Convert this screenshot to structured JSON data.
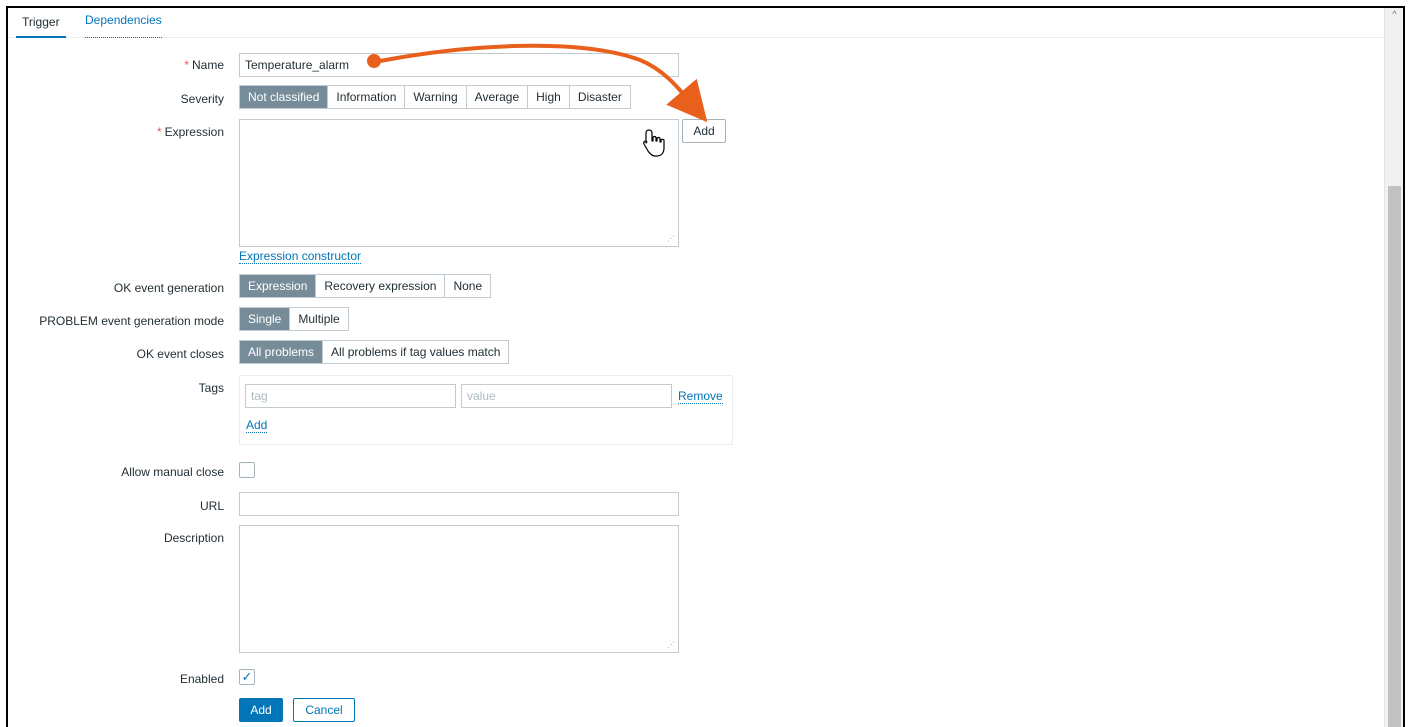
{
  "tabs": [
    {
      "label": "Trigger",
      "active": true
    },
    {
      "label": "Dependencies",
      "active": false
    }
  ],
  "form": {
    "name": {
      "label": "Name",
      "value": "Temperature_alarm",
      "required": true
    },
    "severity": {
      "label": "Severity",
      "options": [
        "Not classified",
        "Information",
        "Warning",
        "Average",
        "High",
        "Disaster"
      ],
      "selected": "Not classified"
    },
    "expression": {
      "label": "Expression",
      "required": true,
      "value": "",
      "add_label": "Add",
      "constructor_link": "Expression constructor"
    },
    "ok_event_generation": {
      "label": "OK event generation",
      "options": [
        "Expression",
        "Recovery expression",
        "None"
      ],
      "selected": "Expression"
    },
    "problem_mode": {
      "label": "PROBLEM event generation mode",
      "options": [
        "Single",
        "Multiple"
      ],
      "selected": "Single"
    },
    "ok_event_closes": {
      "label": "OK event closes",
      "options": [
        "All problems",
        "All problems if tag values match"
      ],
      "selected": "All problems"
    },
    "tags": {
      "label": "Tags",
      "tag_placeholder": "tag",
      "value_placeholder": "value",
      "remove_label": "Remove",
      "add_label": "Add"
    },
    "allow_manual_close": {
      "label": "Allow manual close",
      "checked": false
    },
    "url": {
      "label": "URL",
      "value": ""
    },
    "description": {
      "label": "Description",
      "value": ""
    },
    "enabled": {
      "label": "Enabled",
      "checked": true
    },
    "buttons": {
      "add": "Add",
      "cancel": "Cancel"
    }
  },
  "annotation": {
    "color": "#e8601c",
    "cursor_icon": "hand-pointer-icon"
  },
  "colors": {
    "accent": "#0275b8",
    "selected_segment": "#768d99",
    "required": "#e45959"
  }
}
